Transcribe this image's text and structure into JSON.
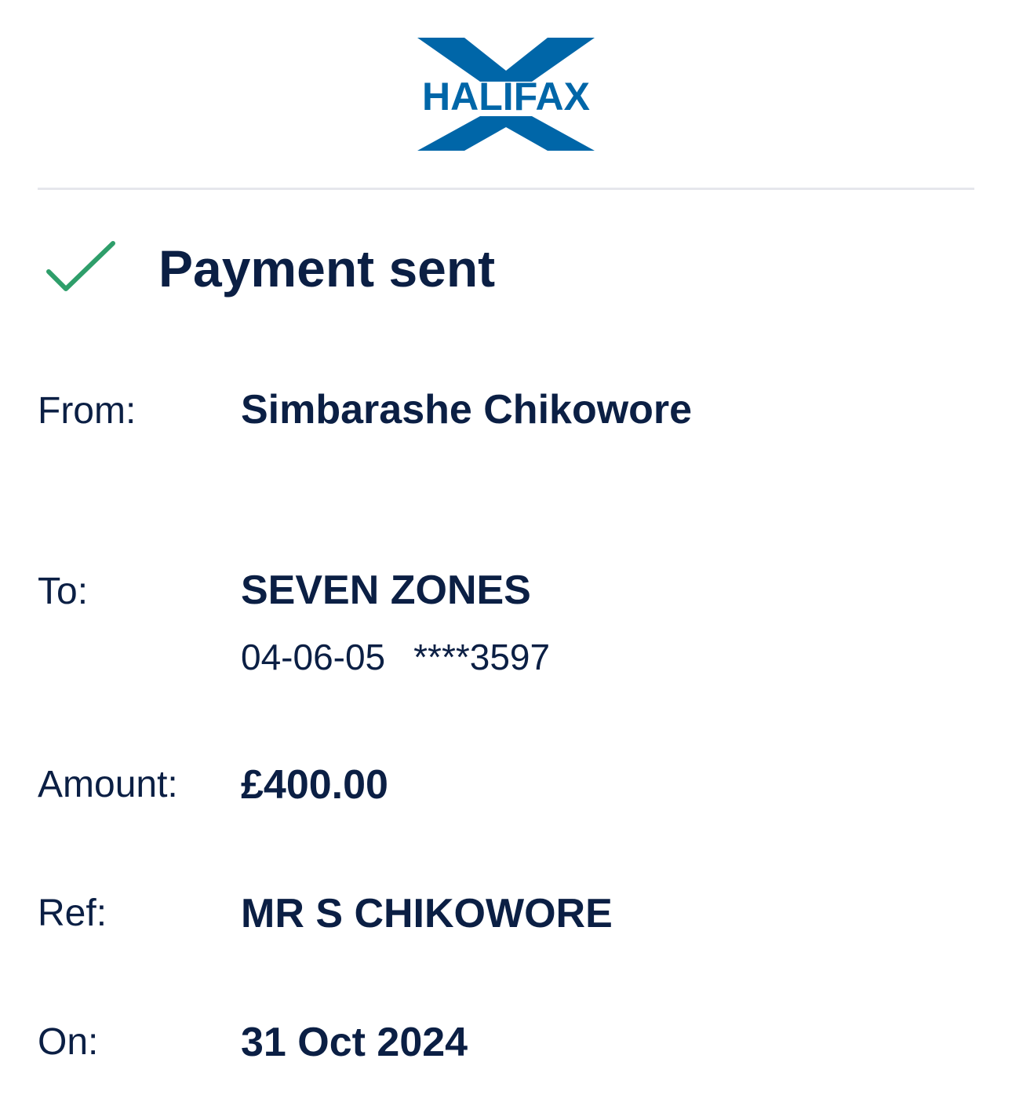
{
  "brand": {
    "name": "HALIFAX",
    "logo_color": "#0066a8"
  },
  "status": {
    "title": "Payment sent",
    "icon": "check-icon",
    "icon_color": "#2e9e6a"
  },
  "details": {
    "from": {
      "label": "From:",
      "value": "Simbarashe Chikowore"
    },
    "to": {
      "label": "To:",
      "value": "SEVEN ZONES",
      "sort_code": "04-06-05",
      "account": "****3597"
    },
    "amount": {
      "label": "Amount:",
      "value": "£400.00"
    },
    "ref": {
      "label": "Ref:",
      "value": "MR S CHIKOWORE"
    },
    "on": {
      "label": "On:",
      "value": "31 Oct 2024"
    }
  },
  "colors": {
    "text": "#0b1f44",
    "divider": "#e6e7ec"
  }
}
